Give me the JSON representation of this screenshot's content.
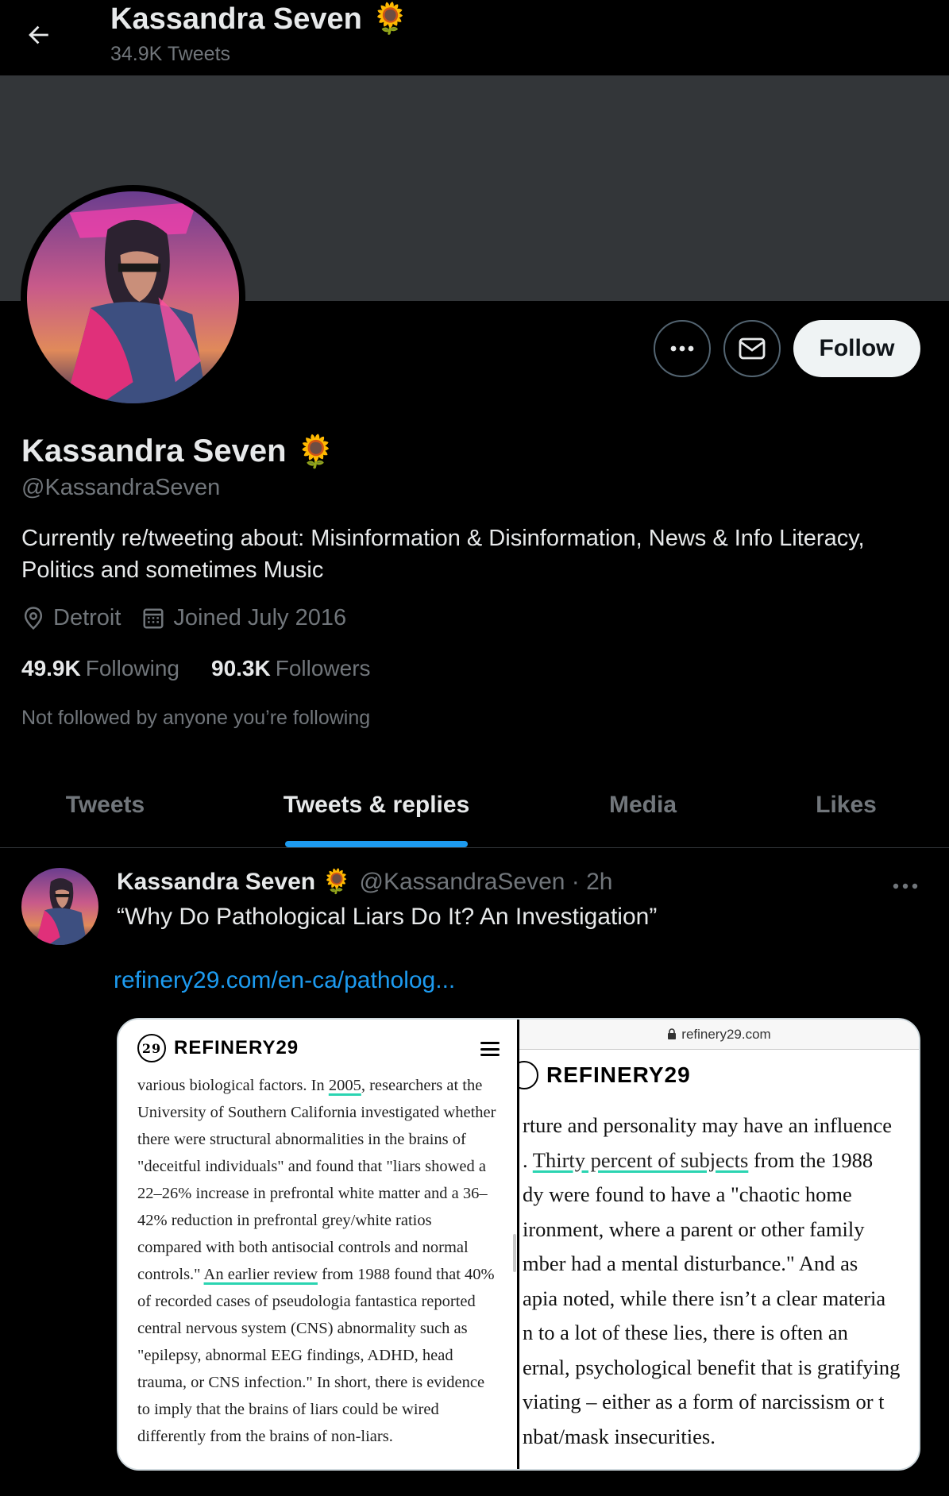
{
  "header": {
    "title": "Kassandra Seven",
    "title_emoji": "🌻",
    "subtitle": "34.9K Tweets"
  },
  "actions": {
    "follow_label": "Follow"
  },
  "profile": {
    "name": "Kassandra Seven",
    "name_emoji": "🌻",
    "handle": "@KassandraSeven",
    "bio": "Currently re/tweeting about: Misinformation & Disinformation, News & Info Literacy, Politics and sometimes Music",
    "location": "Detroit",
    "joined": "Joined July 2016",
    "following_count": "49.9K",
    "following_label": "Following",
    "followers_count": "90.3K",
    "followers_label": "Followers",
    "not_followed": "Not followed by anyone you’re following"
  },
  "tabs": [
    {
      "label": "Tweets",
      "active": false
    },
    {
      "label": "Tweets & replies",
      "active": true
    },
    {
      "label": "Media",
      "active": false
    },
    {
      "label": "Likes",
      "active": false
    }
  ],
  "tweet": {
    "author": "Kassandra Seven",
    "author_emoji": "🌻",
    "handle_time": "@KassandraSeven · 2h",
    "text": "“Why Do Pathological Liars Do It? An Investigation”",
    "link": "refinery29.com/en-ca/patholog...",
    "media": {
      "left_logo": "REFINERY29",
      "left_logo_mark": "29",
      "left_pre": "various biological factors. In ",
      "left_link1": "2005",
      "left_mid": ", researchers at the University of Southern California investigated whether there were structural abnormalities in the brains of \"deceitful individuals\" and found that \"liars showed a 22–26% increase in prefrontal white matter and a 36–42% reduction in prefrontal grey/white ratios compared with both antisocial controls and normal controls.\" ",
      "left_link2": "An earlier review",
      "left_post": " from 1988 found that 40% of recorded cases of pseudologia fantastica reported central nervous system (CNS) abnormality such as \"epilepsy, abnormal EEG findings, ADHD, head trauma, or CNS infection.\" In short, there is evidence to imply that the brains of liars could be wired differently from the brains of non-liars.",
      "right_url": "refinery29.com",
      "right_logo": "REFINERY29",
      "right_lines": [
        "rture and personality may have an influence",
        "dy were found to have a \"chaotic home",
        "ironment, where a parent or other family",
        "mber had a mental disturbance.\" And as",
        "apia noted, while there isn’t a clear materia",
        "n to a lot of these lies, there is often an",
        "ernal, psychological benefit that is gratifying",
        "viating – either as a form of narcissism or t",
        "nbat/mask insecurities."
      ],
      "right_line2_pre": ". ",
      "right_line2_link": "Thirty percent of subjects",
      "right_line2_post": " from the 1988"
    }
  },
  "colors": {
    "accent": "#1d9bf0",
    "background": "#000000",
    "banner": "#333639",
    "muted_text": "#71767b"
  },
  "icons": [
    "back-arrow-icon",
    "more-icon",
    "mail-icon",
    "location-icon",
    "calendar-icon",
    "lock-icon",
    "refinery29-logo-icon",
    "menu-icon"
  ]
}
